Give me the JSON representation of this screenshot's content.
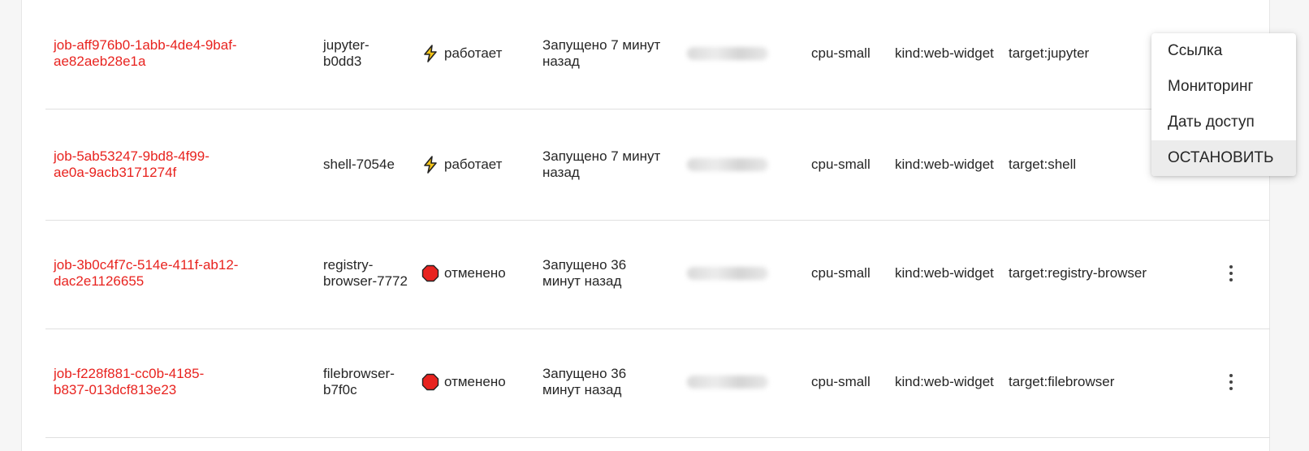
{
  "rows": [
    {
      "job_id_line1": "job-aff976b0-1abb-4de4-9baf-",
      "job_id_line2": "ae82aeb28e1a",
      "name_line1": "jupyter-",
      "name_line2": "b0dd3",
      "status": "работает",
      "status_icon": "lightning-icon",
      "started_line1": "Запущено 7 минут",
      "started_line2": "назад",
      "preset": "cpu-small",
      "tag_kind": "kind:web-widget",
      "tag_target": "target:jupyter"
    },
    {
      "job_id_line1": "job-5ab53247-9bd8-4f99-",
      "job_id_line2": "ae0a-9acb3171274f",
      "name_line1": "shell-7054e",
      "name_line2": "",
      "status": "работает",
      "status_icon": "lightning-icon",
      "started_line1": "Запущено 7 минут",
      "started_line2": "назад",
      "preset": "cpu-small",
      "tag_kind": "kind:web-widget",
      "tag_target": "target:shell"
    },
    {
      "job_id_line1": "job-3b0c4f7c-514e-411f-ab12-",
      "job_id_line2": "dac2e1126655",
      "name_line1": "registry-",
      "name_line2": "browser-7772",
      "status": "отменено",
      "status_icon": "stop-icon",
      "started_line1": "Запущено 36",
      "started_line2": "минут назад",
      "preset": "cpu-small",
      "tag_kind": "kind:web-widget",
      "tag_target": "target:registry-browser"
    },
    {
      "job_id_line1": "job-f228f881-cc0b-4185-",
      "job_id_line2": "b837-013dcf813e23",
      "name_line1": "filebrowser-",
      "name_line2": "b7f0c",
      "status": "отменено",
      "status_icon": "stop-icon",
      "started_line1": "Запущено 36",
      "started_line2": "минут назад",
      "preset": "cpu-small",
      "tag_kind": "kind:web-widget",
      "tag_target": "target:filebrowser"
    }
  ],
  "menu": {
    "items": [
      "Ссылка",
      "Мониторинг",
      "Дать доступ",
      "ОСТАНОВИТЬ"
    ]
  },
  "colors": {
    "job_link": "#e8231f",
    "lightning": "#f5c518",
    "stop": "#e8231f"
  }
}
